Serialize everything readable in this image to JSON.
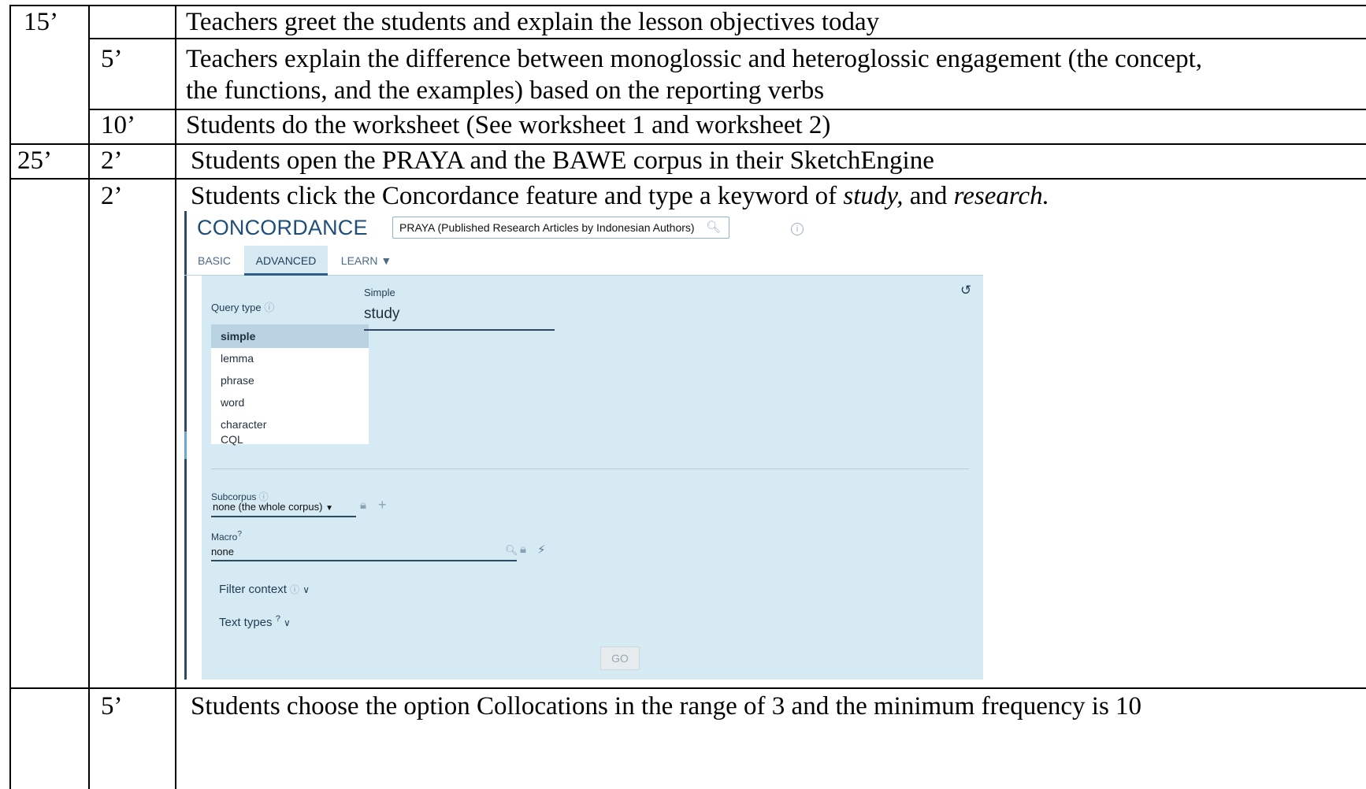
{
  "rows": [
    {
      "total": "15’",
      "step": "",
      "activity": "Teachers greet the students and explain the lesson objectives today"
    },
    {
      "total": "",
      "step": "5’",
      "activity_lines": [
        "Teachers explain the difference between monoglossic and heteroglossic engagement (the concept,",
        "the functions, and the examples) based on the reporting verbs"
      ]
    },
    {
      "total": "",
      "step": "10’",
      "activity": "Students do the worksheet (See worksheet 1 and worksheet 2)"
    },
    {
      "total": "25’",
      "step": "2’",
      "activity": "Students open the PRAYA and the BAWE corpus in their SketchEngine"
    },
    {
      "total": "",
      "step": "2’",
      "activity_prefix": "Students click the Concordance feature and type a keyword of ",
      "keyword1": "study,",
      "activity_mid": " and ",
      "keyword2": "research."
    },
    {
      "total": "",
      "step": "5’",
      "activity": "Students choose the option Collocations in the range of 3 and the minimum frequency is 10"
    }
  ],
  "screenshot": {
    "title": "CONCORDANCE",
    "corpus": "PRAYA (Published Research Articles by Indonesian Authors)",
    "tabs": [
      "BASIC",
      "ADVANCED",
      "LEARN"
    ],
    "active_tab": "ADVANCED",
    "query_type_label": "Query type",
    "query_types": [
      "simple",
      "lemma",
      "phrase",
      "word",
      "character",
      "CQL"
    ],
    "selected_query_type": "simple",
    "input_label": "Simple",
    "input_value": "study",
    "subcorpus_label": "Subcorpus",
    "subcorpus_value": "none (the whole corpus)",
    "macro_label": "Macro",
    "macro_sup": "?",
    "macro_value": "none",
    "filter_context": "Filter context",
    "text_types": "Text types",
    "text_types_sup": "?",
    "go_label": "GO"
  }
}
